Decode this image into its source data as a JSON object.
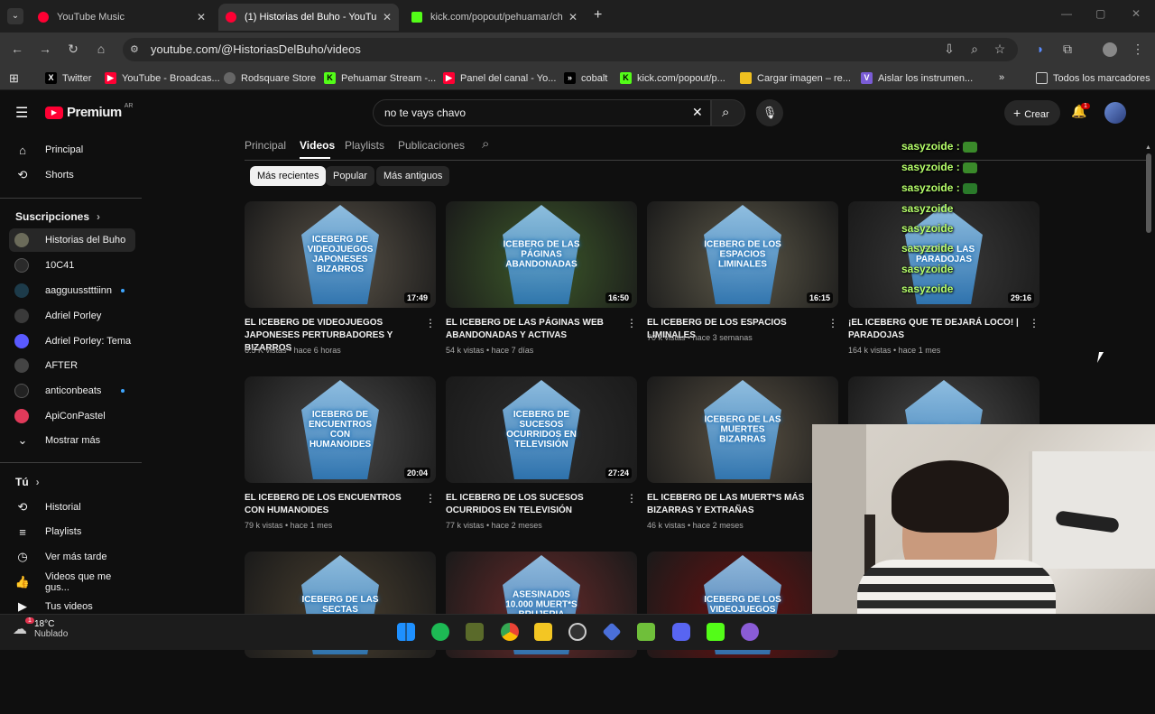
{
  "tabs": [
    {
      "title": "YouTube Music"
    },
    {
      "title": "(1) Historias del Buho - YouTub"
    },
    {
      "title": "kick.com/popout/pehuamar/ch"
    }
  ],
  "address_bar": {
    "url": "youtube.com/@HistoriasDelBuho/videos"
  },
  "bookmarks": [
    {
      "label": "Twitter"
    },
    {
      "label": "YouTube - Broadcas..."
    },
    {
      "label": "Rodsquare Store"
    },
    {
      "label": "Pehuamar Stream -..."
    },
    {
      "label": "Panel del canal - Yo..."
    },
    {
      "label": "cobalt"
    },
    {
      "label": "kick.com/popout/p..."
    },
    {
      "label": "Cargar imagen – re..."
    },
    {
      "label": "Aislar los instrumen..."
    },
    {
      "label": "Todos los marcadores"
    }
  ],
  "header": {
    "logo": "Premium",
    "logo_region": "AR",
    "search_value": "no te vays chavo",
    "create_label": "Crear",
    "notif_count": "1"
  },
  "sidebar": {
    "main": [
      {
        "label": "Principal",
        "icon": "home-icon"
      },
      {
        "label": "Shorts",
        "icon": "shorts-icon"
      }
    ],
    "subs_title": "Suscripciones",
    "subs": [
      {
        "label": "Historias del Buho",
        "color": "#6b6b5a",
        "selected": true,
        "dot": false
      },
      {
        "label": "10C41",
        "color": "#2a2a2a",
        "dot": false
      },
      {
        "label": "aagguusstttiinn",
        "color": "#1d3b4a",
        "dot": true
      },
      {
        "label": "Adriel Porley",
        "color": "#3a3a3a",
        "dot": false
      },
      {
        "label": "Adriel Porley: Tema",
        "color": "#5a5aff",
        "dot": false
      },
      {
        "label": "AFTER",
        "color": "#444",
        "dot": false
      },
      {
        "label": "anticonbeats",
        "color": "#222",
        "dot": true
      },
      {
        "label": "ApiConPastel",
        "color": "#e03a5a",
        "dot": false
      }
    ],
    "more_label": "Mostrar más",
    "you_title": "Tú",
    "you": [
      {
        "label": "Historial",
        "icon": "history-icon"
      },
      {
        "label": "Playlists",
        "icon": "playlists-icon"
      },
      {
        "label": "Ver más tarde",
        "icon": "watch-later-icon"
      },
      {
        "label": "Videos que me gus...",
        "icon": "like-icon"
      },
      {
        "label": "Tus videos",
        "icon": "your-videos-icon"
      }
    ]
  },
  "channel_tabs": [
    "Principal",
    "Videos",
    "Playlists",
    "Publicaciones"
  ],
  "chips": [
    "Más recientes",
    "Popular",
    "Más antiguos"
  ],
  "videos": [
    {
      "title": "EL ICEBERG DE VIDEOJUEGOS JAPONESES PERTURBADORES Y BIZARROS",
      "meta": "6.5 K vistas • hace 6 horas",
      "duration": "17:49",
      "thumb_word": "ICEBERG DE VIDEOJUEGOS JAPONESES BIZARROS",
      "bg": "#5a5348"
    },
    {
      "title": "EL ICEBERG DE LAS PÁGINAS WEB ABANDONADAS Y ACTIVAS",
      "meta": "54 k vistas • hace 7 días",
      "duration": "16:50",
      "thumb_word": "ICEBERG DE LAS PÁGINAS ABANDONADAS",
      "bg": "#3d5a2a"
    },
    {
      "title": "EL ICEBERG DE LOS ESPACIOS LIMINALES",
      "meta": "70 k vistas • hace 3 semanas",
      "duration": "16:15",
      "thumb_word": "ICEBERG DE LOS ESPACIOS LIMINALES",
      "bg": "#5e5a4a"
    },
    {
      "title": "¡EL ICEBERG QUE TE DEJARÁ LOCO! | PARADOJAS",
      "meta": "164 k vistas • hace 1 mes",
      "duration": "29:16",
      "thumb_word": "ICEBERG LAS PARADOJAS",
      "bg": "#3a3a3a"
    },
    {
      "title": "EL ICEBERG DE LOS ENCUENTROS CON HUMANOIDES",
      "meta": "79 k vistas • hace 1 mes",
      "duration": "20:04",
      "thumb_word": "ICEBERG DE ENCUENTROS CON HUMANOIDES",
      "bg": "#4a4a4a"
    },
    {
      "title": "EL ICEBERG DE LOS SUCESOS OCURRIDOS EN TELEVISIÓN",
      "meta": "77 k vistas • hace 2 meses",
      "duration": "27:24",
      "thumb_word": "ICEBERG DE SUCESOS OCURRIDOS EN TELEVISIÓN",
      "bg": "#2e2e2e"
    },
    {
      "title": "EL ICEBERG DE LAS MUERT*S MÁS BIZARRAS Y EXTRAÑAS",
      "meta": "46 k vistas • hace 2 meses",
      "duration": "",
      "thumb_word": "ICEBERG DE LAS MUERTES BIZARRAS",
      "bg": "#5a5244"
    },
    {
      "title": "",
      "meta": "",
      "duration": "",
      "thumb_word": "ICEBERG DE LOS",
      "bg": "#4a4a4a"
    },
    {
      "title": "",
      "meta": "",
      "duration": "",
      "thumb_word": "ICEBERG DE LAS SECTAS",
      "bg": "#4a4030"
    },
    {
      "title": "",
      "meta": "",
      "duration": "",
      "thumb_word": "ASESINAD0S 10.000 MUERT*S BRUJERIA",
      "bg": "#6a2a2a"
    },
    {
      "title": "",
      "meta": "",
      "duration": "",
      "thumb_word": "ICEBERG DE LOS VIDEOJUEGOS",
      "bg": "#6a1010"
    }
  ],
  "chat": [
    {
      "user": "sasyzoide :"
    },
    {
      "user": "sasyzoide :"
    },
    {
      "user": "sasyzoide :"
    },
    {
      "user": "sasyzoide"
    },
    {
      "user": "sasyzoide"
    },
    {
      "user": "sasyzoide"
    },
    {
      "user": "sasyzoide"
    },
    {
      "user": "sasyzoide"
    }
  ],
  "taskbar": {
    "temp": "18°C",
    "weather": "Nublado",
    "weather_badge": "1"
  }
}
